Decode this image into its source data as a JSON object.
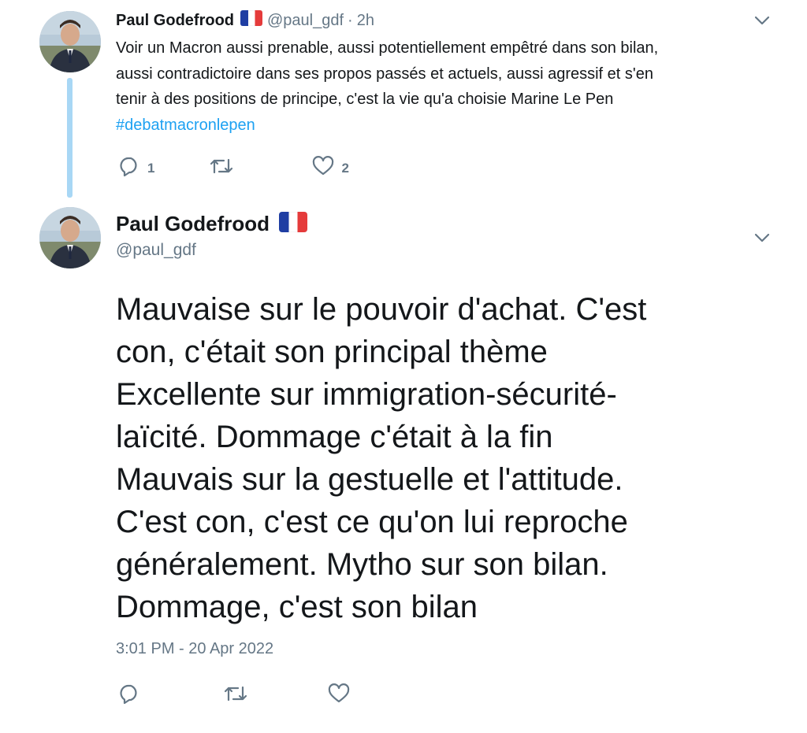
{
  "colors": {
    "text": "#14171a",
    "secondary": "#657786",
    "link": "#1da1f2",
    "thread_line": "#a8d7f5"
  },
  "tweet1": {
    "author_name": "Paul Godefrood",
    "flag": "french-flag",
    "handle": "@paul_gdf",
    "separator": "·",
    "time": "2h",
    "text_lines": [
      "Voir un Macron aussi prenable, aussi potentiellement empêtré dans son bilan,",
      "aussi contradictoire dans ses propos passés et actuels, aussi agressif et s'en",
      "tenir à des positions de principe, c'est la vie qu'a choisie Marine Le Pen"
    ],
    "hashtag": "#debatmacronlepen",
    "replies": "1",
    "likes": "2"
  },
  "tweet2": {
    "author_name": "Paul Godefrood",
    "flag": "french-flag",
    "handle": "@paul_gdf",
    "text_lines": [
      "Mauvaise sur le pouvoir d'achat. C'est",
      "con, c'était son principal thème",
      "Excellente sur immigration-sécurité-",
      "laïcité. Dommage c'était à la fin",
      "Mauvais sur la gestuelle et l'attitude.",
      "C'est con, c'est ce qu'on lui reproche",
      "généralement. Mytho sur son bilan.",
      "Dommage, c'est son bilan"
    ],
    "timestamp": "3:01 PM - 20 Apr 2022"
  },
  "icons": {
    "reply": "reply-icon",
    "retweet": "retweet-icon",
    "like": "heart-icon",
    "more": "chevron-down-icon"
  }
}
